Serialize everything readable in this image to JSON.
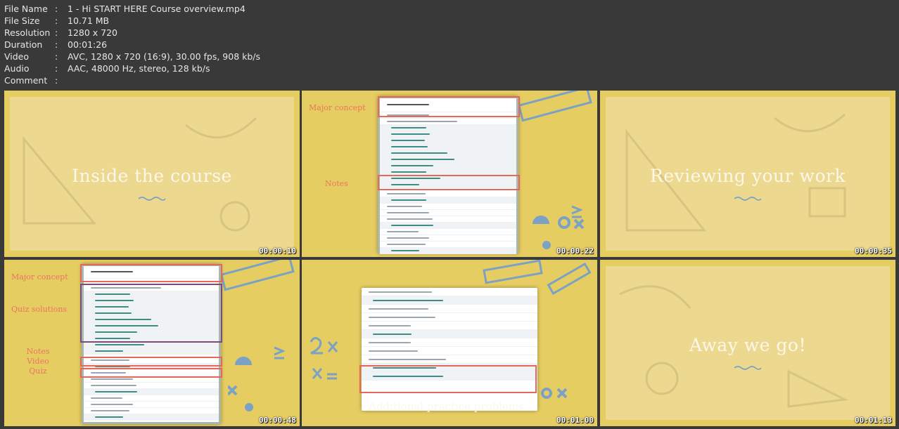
{
  "info": [
    {
      "key": "File Name",
      "value": "1 - Hi START HERE Course overview.mp4"
    },
    {
      "key": "File Size",
      "value": "10.71 MB"
    },
    {
      "key": "Resolution",
      "value": "1280 x 720"
    },
    {
      "key": "Duration",
      "value": "00:01:26"
    },
    {
      "key": "Video",
      "value": "AVC, 1280 x 720 (16:9), 30.00 fps, 908 kb/s"
    },
    {
      "key": "Audio",
      "value": "AAC, 48000 Hz, stereo, 128 kb/s"
    },
    {
      "key": "Comment",
      "value": ""
    }
  ],
  "separator": ":",
  "thumbs": [
    {
      "title": "Inside the course",
      "timestamp": "00:00:10"
    },
    {
      "timestamp": "00:00:22",
      "labels": {
        "major": "Major concept",
        "notes": "Notes"
      }
    },
    {
      "title": "Reviewing your work",
      "timestamp": "00:00:35"
    },
    {
      "timestamp": "00:00:48",
      "labels": {
        "major": "Major concept",
        "quiz": "Quiz solutions",
        "notes": "Notes",
        "video": "Video",
        "quiz2": "Quiz"
      }
    },
    {
      "timestamp": "00:01:00",
      "caption": "Additional practice problems"
    },
    {
      "title": "Away we go!",
      "timestamp": "00:01:13"
    }
  ],
  "colors": {
    "bg": "#393939",
    "slide": "#e6cd62",
    "highlight": "#e5685a",
    "accent": "#e8765d"
  }
}
